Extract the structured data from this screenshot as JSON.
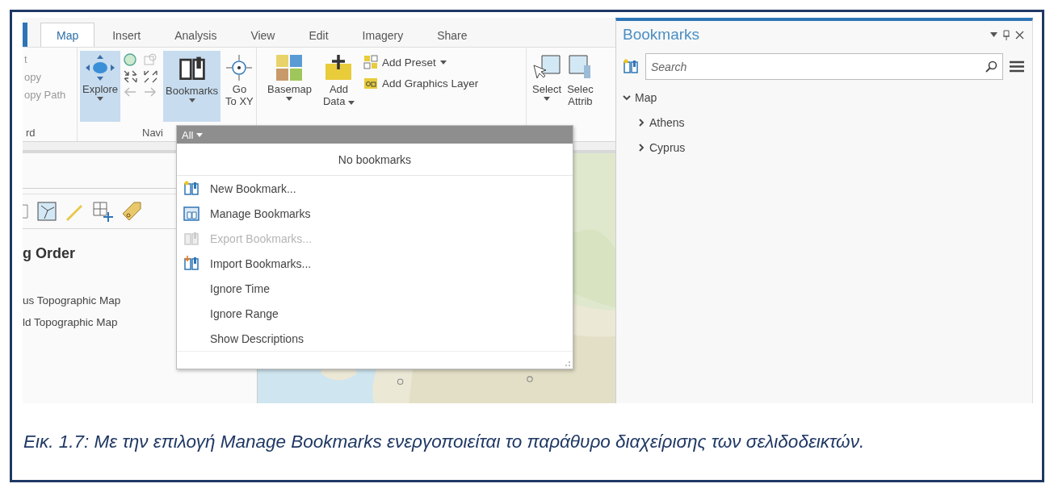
{
  "ribbon": {
    "tabs": [
      {
        "label": "Map",
        "selected": true
      },
      {
        "label": "Insert",
        "selected": false
      },
      {
        "label": "Analysis",
        "selected": false
      },
      {
        "label": "View",
        "selected": false
      },
      {
        "label": "Edit",
        "selected": false
      },
      {
        "label": "Imagery",
        "selected": false
      },
      {
        "label": "Share",
        "selected": false
      }
    ],
    "clipboard": {
      "items": [
        "t",
        "opy",
        "opy Path"
      ],
      "label": "rd"
    },
    "navigation": {
      "label": "Navi",
      "explore": {
        "label": "Explore",
        "selected": true
      },
      "bookmarks": {
        "label": "Bookmarks",
        "selected": true
      },
      "go_to_xy": [
        "Go",
        "To XY"
      ]
    },
    "layer": {
      "basemap": "Basemap",
      "add_data": [
        "Add",
        "Data"
      ],
      "add_preset": "Add Preset",
      "add_graphics_layer": "Add Graphics Layer"
    },
    "selection": {
      "select": "Select",
      "select_by_attributes": [
        "Selec",
        "Attrib"
      ]
    }
  },
  "contents_pane": {
    "heading": "g Order",
    "layers": [
      "us Topographic Map",
      "ld Topographic Map"
    ]
  },
  "bookmarks_menu": {
    "filter": "All",
    "empty_text": "No bookmarks",
    "items": [
      {
        "kind": "command",
        "label": "New Bookmark...",
        "disabled": false
      },
      {
        "kind": "command",
        "label": "Manage Bookmarks",
        "disabled": false
      },
      {
        "kind": "command",
        "label": "Export Bookmarks...",
        "disabled": true
      },
      {
        "kind": "command",
        "label": "Import Bookmarks...",
        "disabled": false
      },
      {
        "kind": "option",
        "label": "Ignore Time",
        "disabled": false
      },
      {
        "kind": "option",
        "label": "Ignore Range",
        "disabled": false
      },
      {
        "kind": "option",
        "label": "Show Descriptions",
        "disabled": false
      }
    ]
  },
  "bookmarks_pane": {
    "title": "Bookmarks",
    "search": {
      "placeholder": "Search"
    },
    "tree": [
      {
        "label": "Map",
        "expanded": true,
        "children": [
          {
            "label": "Athens",
            "expanded": false
          },
          {
            "label": "Cyprus",
            "expanded": false
          }
        ]
      }
    ]
  },
  "caption": "Εικ. 1.7: Με την επιλογή Manage Bookmarks ενεργοποιείται το παράθυρο διαχείρισης των σελιδοδεικτών."
}
